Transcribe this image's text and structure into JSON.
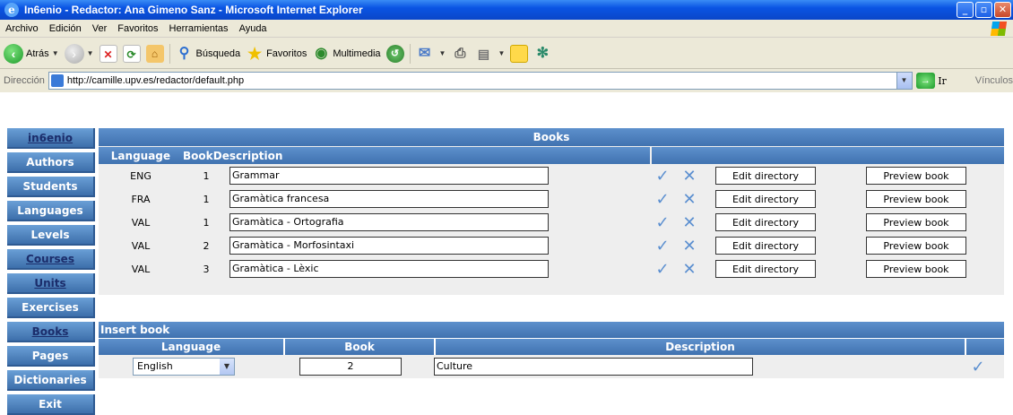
{
  "window": {
    "title": "In6enio - Redactor: Ana Gimeno Sanz - Microsoft Internet Explorer",
    "min": "_",
    "max": "▫",
    "close": "✕"
  },
  "menu": [
    "Archivo",
    "Edición",
    "Ver",
    "Favoritos",
    "Herramientas",
    "Ayuda"
  ],
  "toolbar": {
    "back": "Atrás",
    "search": "Búsqueda",
    "favorites": "Favoritos",
    "media": "Multimedia"
  },
  "address": {
    "label": "Dirección",
    "url": "http://camille.upv.es/redactor/default.php",
    "go": "Ir",
    "links": "Vínculos"
  },
  "sidebar": [
    "in6enio",
    "Authors",
    "Students",
    "Languages",
    "Levels",
    "Courses",
    "Units",
    "Exercises",
    "Books",
    "Pages",
    "Dictionaries",
    "Exit"
  ],
  "books": {
    "title": "Books",
    "headers": {
      "language": "Language",
      "book": "Book",
      "description": "Description"
    },
    "edit_label": "Edit directory",
    "preview_label": "Preview book",
    "rows": [
      {
        "language": "ENG",
        "book": "1",
        "description": "Grammar"
      },
      {
        "language": "FRA",
        "book": "1",
        "description": "Gramàtica francesa"
      },
      {
        "language": "VAL",
        "book": "1",
        "description": "Gramàtica - Ortografia"
      },
      {
        "language": "VAL",
        "book": "2",
        "description": "Gramàtica - Morfosintaxi"
      },
      {
        "language": "VAL",
        "book": "3",
        "description": "Gramàtica - Lèxic"
      }
    ]
  },
  "insert": {
    "title": "Insert book",
    "headers": {
      "language": "Language",
      "book": "Book",
      "description": "Description"
    },
    "language_value": "English",
    "book_value": "2",
    "description_value": "Culture"
  },
  "colors": {
    "header_blue": "#4f81bd",
    "check_blue": "#5b8fd0",
    "panel_grey": "#eeeeee"
  }
}
